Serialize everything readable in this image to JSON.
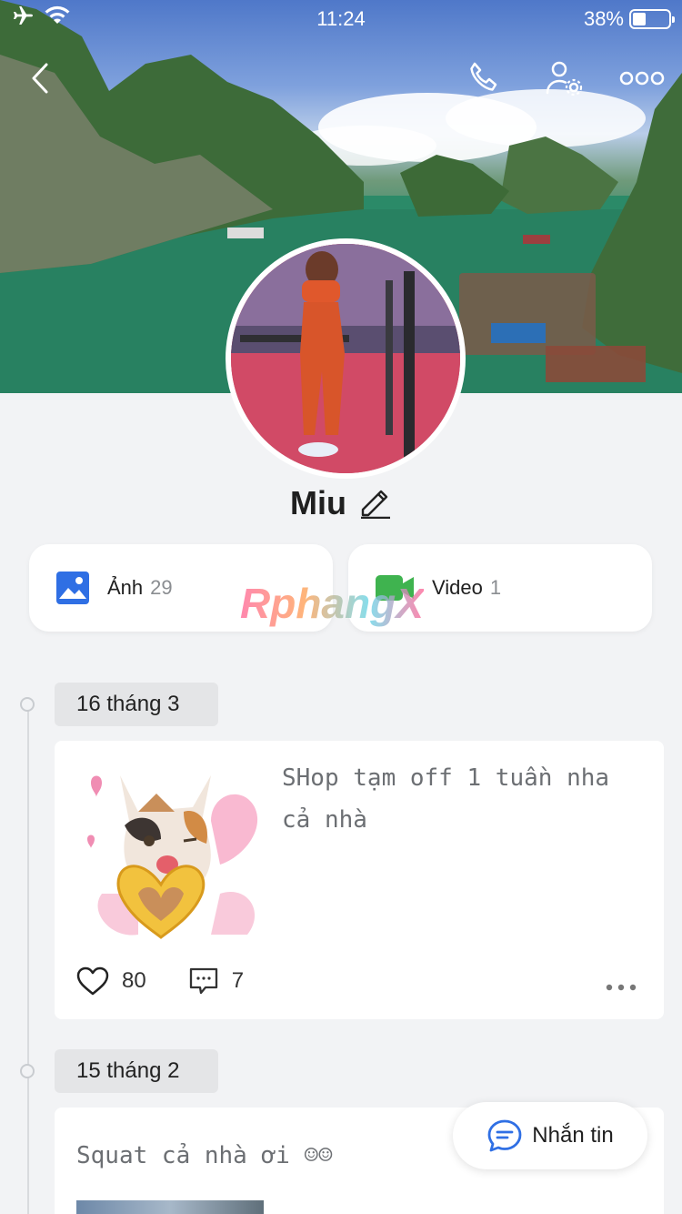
{
  "status_bar": {
    "time": "11:24",
    "battery": "38%",
    "battery_level": 0.38
  },
  "profile": {
    "name": "Miu"
  },
  "media": [
    {
      "label": "Ảnh",
      "count": "29",
      "icon": "photo-icon",
      "color": "#2f6fe4"
    },
    {
      "label": "Video",
      "count": "1",
      "icon": "video-icon",
      "color": "#3fb34f"
    }
  ],
  "watermark": "RphangX",
  "posts": [
    {
      "date": "16 tháng 3",
      "text_line1": "SHop tạm off 1 tuần nha",
      "text_line2": "cả nhà",
      "likes": "80",
      "comments": "7"
    },
    {
      "date": "15 tháng 2",
      "text": "Squat cả nhà ơi ☺☺"
    }
  ],
  "chat_button": {
    "label": "Nhắn tin"
  },
  "colors": {
    "accent": "#2f6fe4",
    "background": "#f2f3f5"
  }
}
